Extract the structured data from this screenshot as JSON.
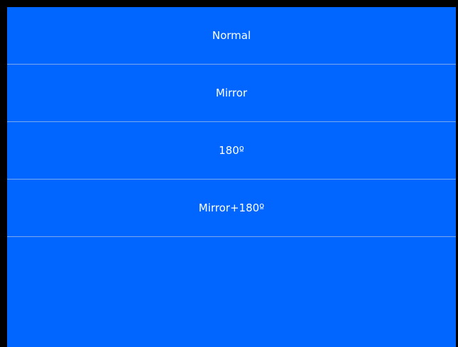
{
  "menu": {
    "items": [
      {
        "label": "Normal"
      },
      {
        "label": "Mirror"
      },
      {
        "label": "180º"
      },
      {
        "label": "Mirror+180º"
      }
    ]
  },
  "colors": {
    "panel_background": "#0066ff",
    "divider": "#7aa8f0",
    "text": "#ffffff",
    "frame": "#000000"
  }
}
